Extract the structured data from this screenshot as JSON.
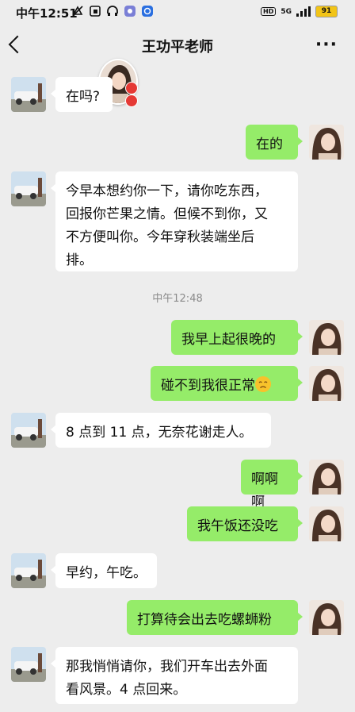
{
  "status_bar": {
    "time": "中午12:51",
    "network": "5G",
    "hd": "HD",
    "battery": "91"
  },
  "header": {
    "title": "王功平老师",
    "back_icon": "chevron-left-icon",
    "more_icon": "more-dots-icon",
    "more_text": "···"
  },
  "messages": [
    {
      "side": "in",
      "text": "在吗?"
    },
    {
      "side": "out",
      "text": "在的"
    },
    {
      "side": "in",
      "text": "今早本想约你一下，请你吃东西，\n回报你芒果之情。但候不到你，又\n不方便叫你。今年穿秋装端坐后\n排。"
    },
    {
      "side": "time",
      "text": "中午12:48"
    },
    {
      "side": "out",
      "text": "我早上起很晚的"
    },
    {
      "side": "out",
      "text": "碰不到我很正常",
      "emoji": "sad-face-emoji"
    },
    {
      "side": "in",
      "text": "8 点到 11 点，无奈花谢走人。"
    },
    {
      "side": "out",
      "text": "啊啊啊"
    },
    {
      "side": "out",
      "text": "我午饭还没吃"
    },
    {
      "side": "in",
      "text": "早约，午吃。"
    },
    {
      "side": "out",
      "text": "打算待会出去吃螺蛳粉"
    },
    {
      "side": "in",
      "text": "那我悄悄请你，我们开车出去外面\n看风景。4 点回来。"
    }
  ]
}
